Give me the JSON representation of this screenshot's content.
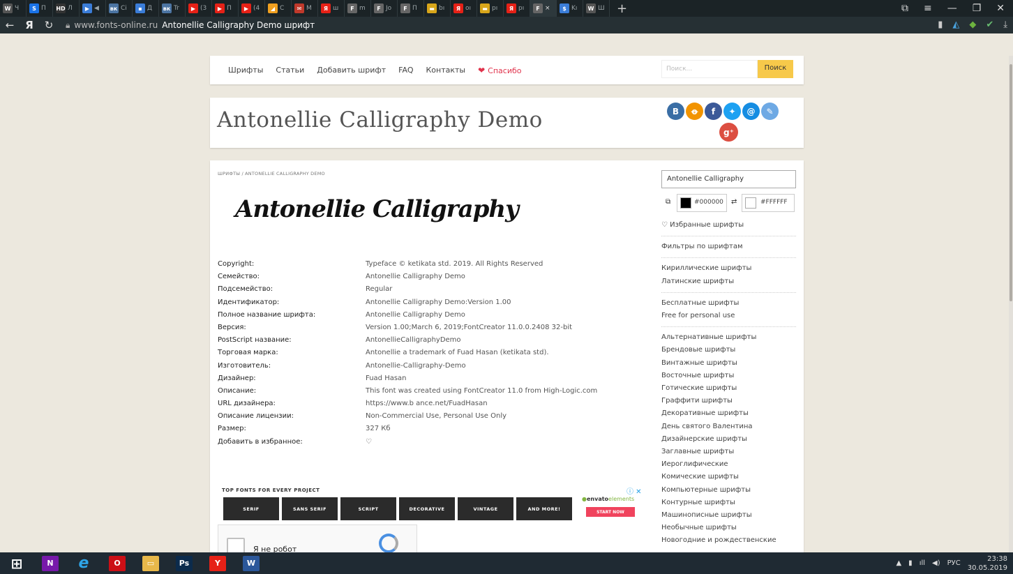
{
  "browser": {
    "tabs": [
      {
        "label": "Ч",
        "icon": "W",
        "color": "#555"
      },
      {
        "label": "П",
        "icon": "S",
        "color": "#1a73e8"
      },
      {
        "label": "Л",
        "icon": "HD",
        "color": "#333"
      },
      {
        "label": "◀",
        "icon": "▶",
        "color": "#3b7dd8"
      },
      {
        "label": "Сі",
        "icon": "вк",
        "color": "#4c75a3"
      },
      {
        "label": "Д",
        "icon": "▪",
        "color": "#3b7dd8"
      },
      {
        "label": "Tr",
        "icon": "вк",
        "color": "#4c75a3"
      },
      {
        "label": "(3",
        "icon": "▶",
        "color": "#e62117"
      },
      {
        "label": "П",
        "icon": "▶",
        "color": "#e62117"
      },
      {
        "label": "(4",
        "icon": "▶",
        "color": "#e62117"
      },
      {
        "label": "С",
        "icon": "◢",
        "color": "#f0a020"
      },
      {
        "label": "М",
        "icon": "✉",
        "color": "#c0392b"
      },
      {
        "label": "ш",
        "icon": "Я",
        "color": "#e62117"
      },
      {
        "label": "m",
        "icon": "F",
        "color": "#666"
      },
      {
        "label": "Jo",
        "icon": "F",
        "color": "#666"
      },
      {
        "label": "П",
        "icon": "F",
        "color": "#666"
      },
      {
        "label": "bı",
        "icon": "▬",
        "color": "#d8a61a"
      },
      {
        "label": "oı",
        "icon": "Я",
        "color": "#e62117"
      },
      {
        "label": "pı",
        "icon": "▬",
        "color": "#d8a61a"
      },
      {
        "label": "pı",
        "icon": "Я",
        "color": "#e62117"
      },
      {
        "label": "×",
        "icon": "F",
        "color": "#666"
      },
      {
        "label": "Kı",
        "icon": "$",
        "color": "#3b7dd8"
      },
      {
        "label": "Ш",
        "icon": "W",
        "color": "#555"
      }
    ],
    "address_domain": "www.fonts-online.ru",
    "address_title": "Antonellie Calligraphy Demo шрифт"
  },
  "nav": {
    "items": [
      "Шрифты",
      "Статьи",
      "Добавить шрифт",
      "FAQ",
      "Контакты"
    ],
    "thanks": "Спасибо",
    "search_placeholder": "Поиск...",
    "search_button": "Поиск"
  },
  "font": {
    "title": "Antonellie Calligraphy Demo",
    "breadcrumb": "ШРИФТЫ   /   ANTONELLIE CALLIGRAPHY DEMO",
    "sample": "Antonellie  Calligraphy",
    "properties": [
      {
        "key": "Copyright:",
        "value": "Typeface © ketikata std. 2019. All Rights Reserved"
      },
      {
        "key": "Семейство:",
        "value": "Antonellie Calligraphy Demo"
      },
      {
        "key": "Подсемейство:",
        "value": "Regular"
      },
      {
        "key": "Идентификатор:",
        "value": "Antonellie Calligraphy Demo:Version 1.00"
      },
      {
        "key": "Полное название шрифта:",
        "value": "Antonellie Calligraphy Demo"
      },
      {
        "key": "Версия:",
        "value": "Version 1.00;March 6, 2019;FontCreator 11.0.0.2408 32-bit"
      },
      {
        "key": "PostScript название:",
        "value": "AntonellieCalligraphyDemo"
      },
      {
        "key": "Торговая марка:",
        "value": "Antonellie a trademark of Fuad Hasan (ketikata std)."
      },
      {
        "key": "Изготовитель:",
        "value": "Antonellie-Calligraphy-Demo"
      },
      {
        "key": "Дизайнер:",
        "value": "Fuad Hasan"
      },
      {
        "key": "Описание:",
        "value": "This font was created using FontCreator 11.0 from High-Logic.com"
      },
      {
        "key": "URL дизайнера:",
        "value": "https://www.b ance.net/FuadHasan"
      },
      {
        "key": "Описание лицензии:",
        "value": "Non-Commercial Use, Personal Use Only"
      },
      {
        "key": "Размер:",
        "value": "327 Кб"
      },
      {
        "key": "Добавить в избранное:",
        "value": "♡"
      }
    ]
  },
  "ad": {
    "title": "TOP FONTS FOR EVERY PROJECT",
    "tiles": [
      "SERIF",
      "SANS SERIF",
      "SCRIPT",
      "DECORATIVE",
      "VINTAGE",
      "AND MORE!"
    ],
    "brand_prefix": "envato",
    "brand_suffix": "elements",
    "cta": "START NOW"
  },
  "captcha": {
    "label": "Я не робот"
  },
  "sidebar": {
    "preview_text": "Antonellie Calligraphy",
    "fg_color": "#000000",
    "bg_color": "#FFFFFF",
    "favorites": "♡ Избранные шрифты",
    "filters": "Фильтры по шрифтам",
    "group1": [
      "Кириллические шрифты",
      "Латинские шрифты"
    ],
    "group2": [
      "Бесплатные шрифты",
      "Free for personal use"
    ],
    "group3": [
      "Альтернативные шрифты",
      "Брендовые шрифты",
      "Винтажные шрифты",
      "Восточные шрифты",
      "Готические шрифты",
      "Граффити шрифты",
      "Декоративные шрифты",
      "День святого Валентина",
      "Дизайнерские шрифты",
      "Заглавные шрифты",
      "Иероглифические",
      "Комические шрифты",
      "Компьютерные шрифты",
      "Контурные шрифты",
      "Машинописные шрифты",
      "Необычные шрифты",
      "Новогодние и рождественские"
    ]
  },
  "taskbar": {
    "apps": [
      {
        "name": "start",
        "glyph": "⊞",
        "color": "transparent"
      },
      {
        "name": "onenote",
        "glyph": "N",
        "color": "#7719aa"
      },
      {
        "name": "ie",
        "glyph": "e",
        "color": "transparent"
      },
      {
        "name": "opera",
        "glyph": "O",
        "color": "#cc0f16"
      },
      {
        "name": "explorer",
        "glyph": "▭",
        "color": "#e8b84a"
      },
      {
        "name": "photoshop",
        "glyph": "Ps",
        "color": "#0c2b4c"
      },
      {
        "name": "yandex",
        "glyph": "Y",
        "color": "#e62117"
      },
      {
        "name": "word",
        "glyph": "W",
        "color": "#2b579a"
      }
    ],
    "lang": "РУС",
    "time": "23:38",
    "date": "30.05.2019"
  }
}
